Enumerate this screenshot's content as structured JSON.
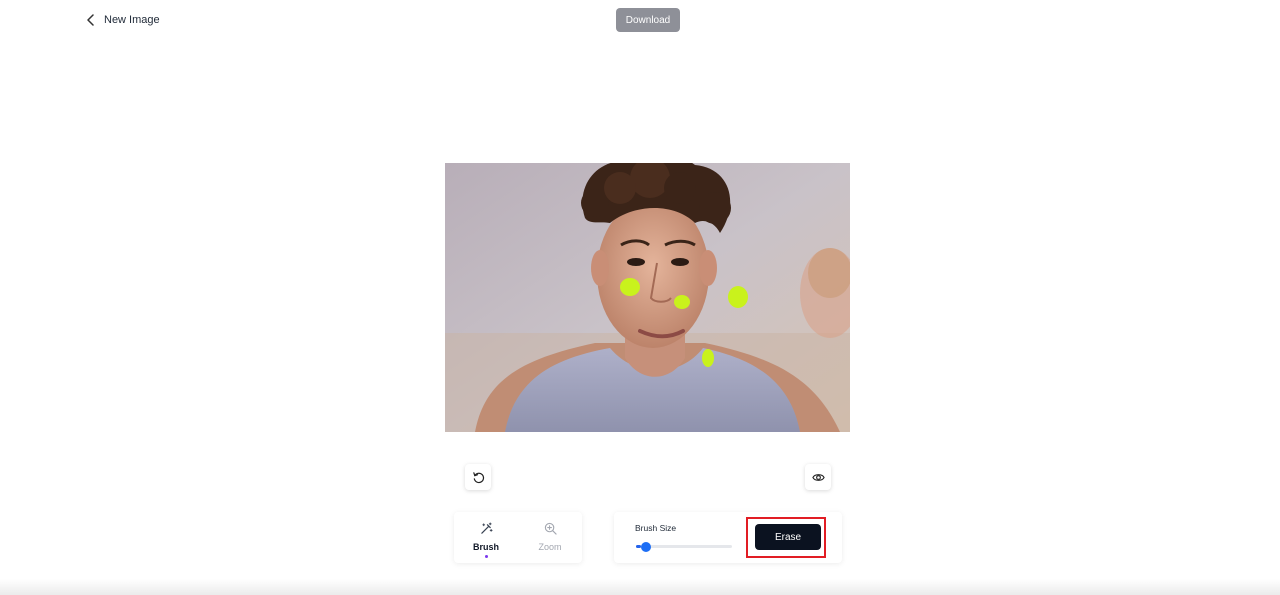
{
  "header": {
    "back_label": "New Image",
    "download_label": "Download"
  },
  "image": {
    "alt": "Portrait of a young man with curly hair",
    "mask_color": "#c9f21c"
  },
  "tools": {
    "brush_label": "Brush",
    "zoom_label": "Zoom",
    "active": "brush"
  },
  "brush_panel": {
    "size_label": "Brush Size",
    "size_value": 0.05,
    "erase_label": "Erase"
  },
  "colors": {
    "download_bg": "#8e9098",
    "erase_bg": "#0b1220",
    "highlight": "#e11d24",
    "slider": "#1d6ef5"
  },
  "icons": {
    "back": "chevron-left-icon",
    "reset": "rotate-ccw-icon",
    "preview": "eye-icon",
    "brush": "magic-wand-icon",
    "zoom": "zoom-in-icon"
  }
}
